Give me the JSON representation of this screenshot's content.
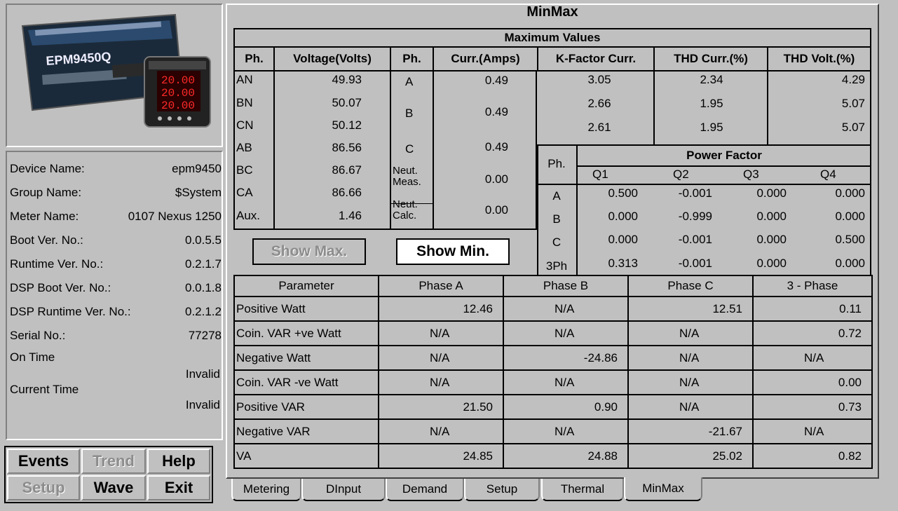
{
  "device_image": {
    "brand": "EPM9450Q",
    "display_digits": [
      "20.00",
      "20.00",
      "20.00"
    ]
  },
  "info": {
    "rows": [
      {
        "label": "Device Name:",
        "value": "epm9450"
      },
      {
        "label": "Group Name:",
        "value": "$System"
      },
      {
        "label": "Meter Name:",
        "value": "0107 Nexus 1250"
      },
      {
        "label": "Boot Ver. No.:",
        "value": "0.0.5.5"
      },
      {
        "label": "Runtime Ver. No.:",
        "value": "0.2.1.7"
      },
      {
        "label": "DSP Boot Ver. No.:",
        "value": "0.0.1.8"
      },
      {
        "label": "DSP Runtime Ver. No.:",
        "value": "0.2.1.2"
      },
      {
        "label": "Serial No.:",
        "value": "77278"
      }
    ],
    "on_time_label": "On Time",
    "on_time_value": "Invalid",
    "current_time_label": "Current Time",
    "current_time_value": "Invalid"
  },
  "buttons": {
    "events": "Events",
    "trend": "Trend",
    "help": "Help",
    "setup": "Setup",
    "wave": "Wave",
    "exit": "Exit"
  },
  "panel_title": "MinMax",
  "max_title": "Maximum Values",
  "headers": {
    "ph": "Ph.",
    "voltage": "Voltage(Volts)",
    "ph2": "Ph.",
    "curr": "Curr.(Amps)",
    "kfactor": "K-Factor Curr.",
    "thd_curr": "THD Curr.(%)",
    "thd_volt": "THD Volt.(%)"
  },
  "voltage_rows": [
    {
      "ph": "AN",
      "v": "49.93"
    },
    {
      "ph": "BN",
      "v": "50.07"
    },
    {
      "ph": "CN",
      "v": "50.12"
    },
    {
      "ph": "AB",
      "v": "86.56"
    },
    {
      "ph": "BC",
      "v": "86.67"
    },
    {
      "ph": "CA",
      "v": "86.66"
    },
    {
      "ph": "Aux.",
      "v": "1.46"
    }
  ],
  "current": {
    "a_label": "A",
    "a_val": "0.49",
    "b_label": "B",
    "b_val": "0.49",
    "c_label": "C",
    "c_val": "0.49",
    "neut_meas_label1": "Neut.",
    "neut_meas_label2": "Meas.",
    "neut_meas_val": "0.00",
    "neut_calc_label1": "Neut.",
    "neut_calc_label2": "Calc.",
    "neut_calc_val": "0.00"
  },
  "harmonics": [
    {
      "k": "3.05",
      "thdc": "2.34",
      "thdv": "4.29"
    },
    {
      "k": "2.66",
      "thdc": "1.95",
      "thdv": "5.07"
    },
    {
      "k": "2.61",
      "thdc": "1.95",
      "thdv": "5.07"
    }
  ],
  "show_max": "Show Max.",
  "show_min": "Show Min.",
  "pf": {
    "ph_label": "Ph.",
    "title": "Power Factor",
    "quadrants": [
      "Q1",
      "Q2",
      "Q3",
      "Q4"
    ],
    "rows": [
      {
        "ph": "A",
        "q": [
          "0.500",
          "-0.001",
          "0.000",
          "0.000"
        ]
      },
      {
        "ph": "B",
        "q": [
          "0.000",
          "-0.999",
          "0.000",
          "0.000"
        ]
      },
      {
        "ph": "C",
        "q": [
          "0.000",
          "-0.001",
          "0.000",
          "0.500"
        ]
      },
      {
        "ph": "3Ph",
        "q": [
          "0.313",
          "-0.001",
          "0.000",
          "0.000"
        ]
      }
    ]
  },
  "power": {
    "headers": [
      "Parameter",
      "Phase A",
      "Phase B",
      "Phase C",
      "3 - Phase"
    ],
    "rows": [
      {
        "p": "Positive Watt",
        "a": "12.46",
        "b": "N/A",
        "c": "12.51",
        "t": "0.11"
      },
      {
        "p": "Coin. VAR +ve Watt",
        "a": "N/A",
        "b": "N/A",
        "c": "N/A",
        "t": "0.72"
      },
      {
        "p": "Negative Watt",
        "a": "N/A",
        "b": "-24.86",
        "c": "N/A",
        "t": "N/A"
      },
      {
        "p": "Coin. VAR -ve Watt",
        "a": "N/A",
        "b": "N/A",
        "c": "N/A",
        "t": "0.00"
      },
      {
        "p": "Positive VAR",
        "a": "21.50",
        "b": "0.90",
        "c": "N/A",
        "t": "0.73"
      },
      {
        "p": "Negative VAR",
        "a": "N/A",
        "b": "N/A",
        "c": "-21.67",
        "t": "N/A"
      },
      {
        "p": "VA",
        "a": "24.85",
        "b": "24.88",
        "c": "25.02",
        "t": "0.82"
      }
    ]
  },
  "tabs": [
    "Metering",
    "DInput",
    "Demand",
    "Setup",
    "Thermal",
    "MinMax"
  ],
  "active_tab": "MinMax"
}
